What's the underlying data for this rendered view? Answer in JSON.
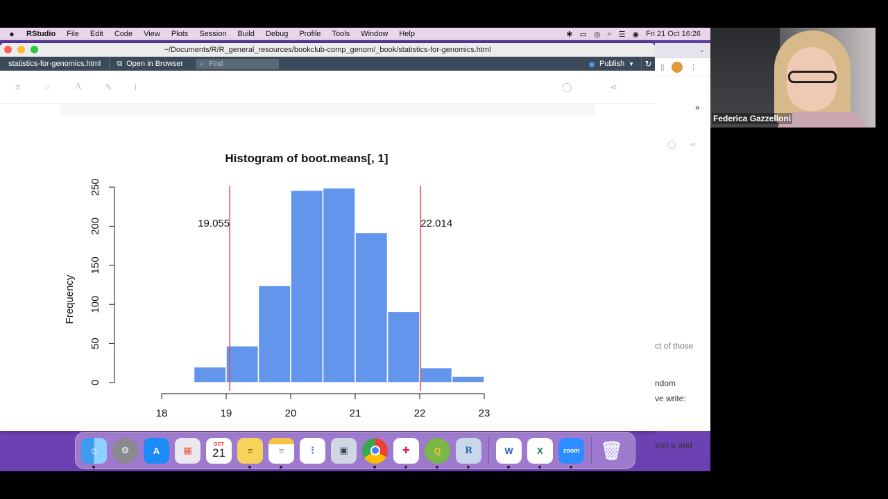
{
  "menubar": {
    "app_name": "RStudio",
    "items": [
      "File",
      "Edit",
      "Code",
      "View",
      "Plots",
      "Session",
      "Build",
      "Debug",
      "Profile",
      "Tools",
      "Window",
      "Help"
    ],
    "datetime": "Fri 21 Oct  16:26"
  },
  "window": {
    "title": "~/Documents/R/R_general_resources/bookclub-comp_genom/_book/statistics-for-genomics.html"
  },
  "viewer_toolbar": {
    "file_tab": "statistics-for-genomics.html",
    "open_in_browser": "Open in Browser",
    "find_placeholder": "Find",
    "publish_label": "Publish"
  },
  "chart_data": {
    "type": "bar",
    "title": "Histogram of boot.means[, 1]",
    "xlabel": "",
    "ylabel": "Frequency",
    "bins": [
      {
        "from": 18.5,
        "to": 19.0,
        "count": 20
      },
      {
        "from": 19.0,
        "to": 19.5,
        "count": 47
      },
      {
        "from": 19.5,
        "to": 20.0,
        "count": 124
      },
      {
        "from": 20.0,
        "to": 20.5,
        "count": 246
      },
      {
        "from": 20.5,
        "to": 21.0,
        "count": 249
      },
      {
        "from": 21.0,
        "to": 21.5,
        "count": 192
      },
      {
        "from": 21.5,
        "to": 22.0,
        "count": 91
      },
      {
        "from": 22.0,
        "to": 22.5,
        "count": 19
      },
      {
        "from": 22.5,
        "to": 23.0,
        "count": 8
      }
    ],
    "xlim": [
      18,
      23
    ],
    "ylim": [
      0,
      250
    ],
    "x_ticks": [
      18,
      19,
      20,
      21,
      22,
      23
    ],
    "y_ticks": [
      0,
      50,
      100,
      150,
      200,
      250
    ],
    "bar_color": "#6495ed",
    "vlines": [
      {
        "x": 19.055,
        "label": "19.055",
        "color": "#d9534f"
      },
      {
        "x": 22.014,
        "label": "22.014",
        "color": "#d9534f"
      }
    ],
    "grid": false
  },
  "bg_browser": {
    "snippets": [
      "ct of those",
      "ndom",
      "ve write:",
      "ean μ and"
    ]
  },
  "dock": {
    "calendar_month": "OCT",
    "calendar_day": "21",
    "zoom_label": "zoom"
  },
  "webcam": {
    "participant_name": "Federica Gazzelloni"
  }
}
